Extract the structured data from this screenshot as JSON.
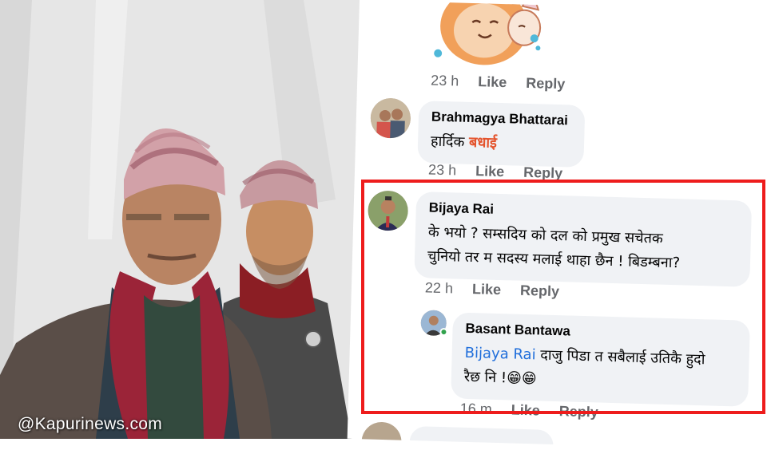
{
  "photo": {
    "watermark": "@Kapurinews.com"
  },
  "comments": [
    {
      "id": "sticker-comment",
      "time": "23 h",
      "like_label": "Like",
      "reply_label": "Reply"
    },
    {
      "id": "brahmagya",
      "author": "Brahmagya Bhattarai",
      "text_part1": "हार्दिक ",
      "text_part2": "बधाई",
      "time": "23 h",
      "like_label": "Like",
      "reply_label": "Reply"
    },
    {
      "id": "bijaya",
      "author": "Bijaya Rai",
      "text_line1": "के भयो ? सम्सदिय को दल को प्रमुख सचेतक",
      "text_line2": "चुनियो तर म सदस्य मलाई थाहा छैन ! बिडम्बना?",
      "time": "22 h",
      "like_label": "Like",
      "reply_label": "Reply"
    },
    {
      "id": "basant",
      "author": "Basant Bantawa",
      "mention": "Bijaya Rai",
      "text_line1_rest": " दाजु पिडा त सबैलाई उतिकै हुदो",
      "text_line2": "रैछ नि !",
      "emoji": "😁😁",
      "time": "16 m",
      "like_label": "Like",
      "reply_label": "Reply"
    }
  ],
  "colors": {
    "highlight_box": "#ee1c1c",
    "mention": "#216fdb",
    "congrats_text": "#e4532c",
    "bubble_bg": "#f0f2f5",
    "meta_text": "#65676b",
    "online": "#31a24c"
  }
}
